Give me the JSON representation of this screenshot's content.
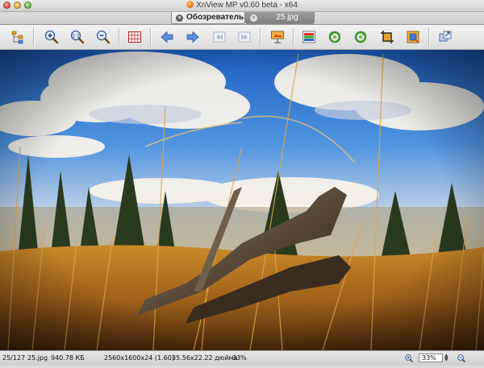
{
  "window": {
    "title": "XnView MP v0.60 beta - x64"
  },
  "tabs": [
    {
      "label": "Обозреватель",
      "close_glyph": "×"
    },
    {
      "label": "25.jpg",
      "close_glyph": "×"
    }
  ],
  "toolbar": {
    "buttons": [
      "browser-tree-icon",
      "zoom-in-icon",
      "zoom-fit-icon",
      "zoom-out-icon",
      "grid-view-icon",
      "previous-arrow-icon",
      "next-arrow-icon",
      "first-image-icon",
      "last-image-icon",
      "slideshow-icon",
      "adjust-colors-icon",
      "rotate-left-icon",
      "rotate-right-icon",
      "crop-icon",
      "resize-icon",
      "fullscreen-icon"
    ]
  },
  "status": {
    "position": "25/127",
    "filename": "25.jpg",
    "filesize": "940.78 КБ",
    "dimensions": "2560x1600x24 (1.60)",
    "print_size": "35.56x22.22 дюйма",
    "zoom": "33%",
    "zoom_field": "33%"
  },
  "colors": {
    "sky_top": "#2a6fc9",
    "grass": "#b8741c"
  }
}
